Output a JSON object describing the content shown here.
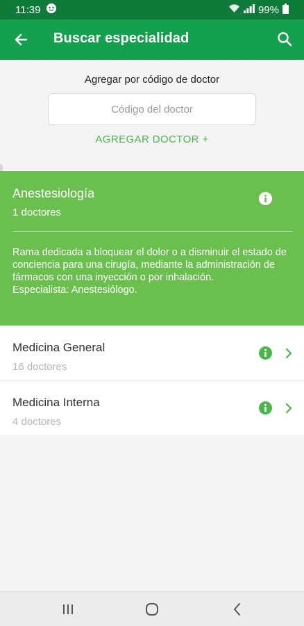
{
  "status_bar": {
    "time": "11:39",
    "battery": "99%",
    "icons": [
      "notification-icon",
      "wifi-icon",
      "signal-icon",
      "battery-icon"
    ]
  },
  "app_bar": {
    "title": "Buscar especialidad",
    "back_icon": "arrow-left-icon",
    "search_icon": "search-icon"
  },
  "add_doctor": {
    "label": "Agregar por código de doctor",
    "input_placeholder": "Código del doctor",
    "input_value": "",
    "button_label": "AGREGAR DOCTOR +"
  },
  "specialties": [
    {
      "name": "Anestesiología",
      "count": "1 doctores",
      "expanded": true,
      "description": "Rama dedicada a bloquear el dolor o a disminuir el estado de conciencia para una cirugía, mediante la administración de fármacos con una inyección o por inhalación.",
      "specialist": "Especialista: Anestesiólogo."
    },
    {
      "name": "Medicina General",
      "count": "16 doctores",
      "expanded": false
    },
    {
      "name": "Medicina Interna",
      "count": "4 doctores",
      "expanded": false
    }
  ],
  "colors": {
    "status_bar": "#0f7a3a",
    "app_bar": "#15a04e",
    "accent": "#4cb54d",
    "expanded_card": "#6abf4f"
  },
  "nav_bar": {
    "icons": [
      "recent-apps-icon",
      "home-icon",
      "back-nav-icon"
    ]
  }
}
